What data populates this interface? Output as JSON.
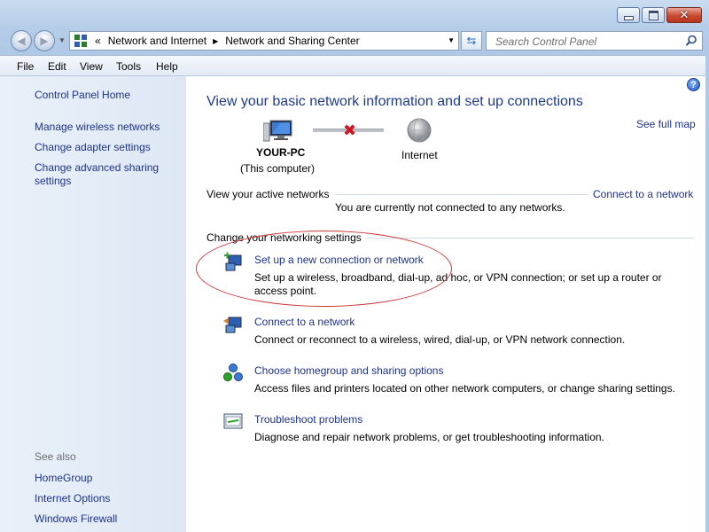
{
  "address": {
    "segments": [
      "Network and Internet",
      "Network and Sharing Center"
    ],
    "separator": "«"
  },
  "search": {
    "placeholder": "Search Control Panel"
  },
  "menu": [
    "File",
    "Edit",
    "View",
    "Tools",
    "Help"
  ],
  "sidebar": {
    "home": "Control Panel Home",
    "items": [
      "Manage wireless networks",
      "Change adapter settings",
      "Change advanced sharing settings"
    ],
    "see_also_label": "See also",
    "see_also": [
      "HomeGroup",
      "Internet Options",
      "Windows Firewall"
    ]
  },
  "main": {
    "title": "View your basic network information and set up connections",
    "see_full_map": "See full map",
    "computer_name": "YOUR-PC",
    "computer_sub": "(This computer)",
    "internet_label": "Internet",
    "active_networks_label": "View your active networks",
    "connect_link": "Connect to a network",
    "not_connected": "You are currently not connected to any networks.",
    "change_settings_label": "Change your networking settings",
    "tasks": [
      {
        "title": "Set up a new connection or network",
        "desc": "Set up a wireless, broadband, dial-up, ad hoc, or VPN connection; or set up a router or access point."
      },
      {
        "title": "Connect to a network",
        "desc": "Connect or reconnect to a wireless, wired, dial-up, or VPN network connection."
      },
      {
        "title": "Choose homegroup and sharing options",
        "desc": "Access files and printers located on other network computers, or change sharing settings."
      },
      {
        "title": "Troubleshoot problems",
        "desc": "Diagnose and repair network problems, or get troubleshooting information."
      }
    ]
  },
  "colors": {
    "link": "#1e3287",
    "title": "#1e3a8a",
    "annotation": "#cc3333"
  }
}
